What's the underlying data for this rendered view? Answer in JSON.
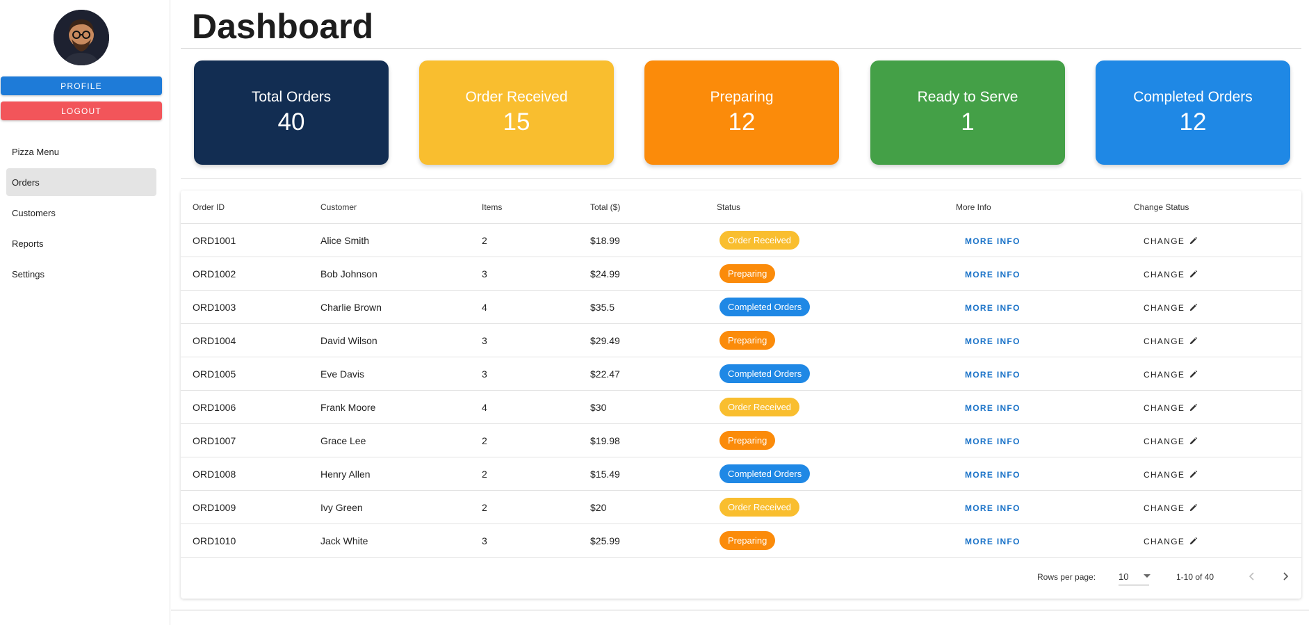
{
  "page": {
    "title": "Dashboard"
  },
  "sidebar": {
    "avatar_alt": "user avatar",
    "profile_label": "PROFILE",
    "logout_label": "LOGOUT",
    "nav": [
      {
        "label": "Pizza Menu",
        "active": false
      },
      {
        "label": "Orders",
        "active": true
      },
      {
        "label": "Customers",
        "active": false
      },
      {
        "label": "Reports",
        "active": false
      },
      {
        "label": "Settings",
        "active": false
      }
    ]
  },
  "cards": [
    {
      "title": "Total Orders",
      "value": "40",
      "color": "#122d52"
    },
    {
      "title": "Order Received",
      "value": "15",
      "color": "#f9be2f"
    },
    {
      "title": "Preparing",
      "value": "12",
      "color": "#fb8b0a"
    },
    {
      "title": "Ready to Serve",
      "value": "1",
      "color": "#44a047"
    },
    {
      "title": "Completed Orders",
      "value": "12",
      "color": "#1f88e5"
    }
  ],
  "table": {
    "headers": {
      "order_id": "Order ID",
      "customer": "Customer",
      "items": "Items",
      "total": "Total ($)",
      "status": "Status",
      "more_info": "More Info",
      "change_status": "Change Status"
    },
    "more_info_label": "MORE INFO",
    "change_label": "CHANGE",
    "status_colors": {
      "Order Received": "#f9be2f",
      "Preparing": "#fb8b0a",
      "Completed Orders": "#1f88e5"
    },
    "rows": [
      {
        "id": "ORD1001",
        "customer": "Alice Smith",
        "items": "2",
        "total": "$18.99",
        "status": "Order Received"
      },
      {
        "id": "ORD1002",
        "customer": "Bob Johnson",
        "items": "3",
        "total": "$24.99",
        "status": "Preparing"
      },
      {
        "id": "ORD1003",
        "customer": "Charlie Brown",
        "items": "4",
        "total": "$35.5",
        "status": "Completed Orders"
      },
      {
        "id": "ORD1004",
        "customer": "David Wilson",
        "items": "3",
        "total": "$29.49",
        "status": "Preparing"
      },
      {
        "id": "ORD1005",
        "customer": "Eve Davis",
        "items": "3",
        "total": "$22.47",
        "status": "Completed Orders"
      },
      {
        "id": "ORD1006",
        "customer": "Frank Moore",
        "items": "4",
        "total": "$30",
        "status": "Order Received"
      },
      {
        "id": "ORD1007",
        "customer": "Grace Lee",
        "items": "2",
        "total": "$19.98",
        "status": "Preparing"
      },
      {
        "id": "ORD1008",
        "customer": "Henry Allen",
        "items": "2",
        "total": "$15.49",
        "status": "Completed Orders"
      },
      {
        "id": "ORD1009",
        "customer": "Ivy Green",
        "items": "2",
        "total": "$20",
        "status": "Order Received"
      },
      {
        "id": "ORD1010",
        "customer": "Jack White",
        "items": "3",
        "total": "$25.99",
        "status": "Preparing"
      }
    ]
  },
  "pagination": {
    "rows_per_page_label": "Rows per page:",
    "rows_per_page_value": "10",
    "range_text": "1-10 of 40"
  }
}
